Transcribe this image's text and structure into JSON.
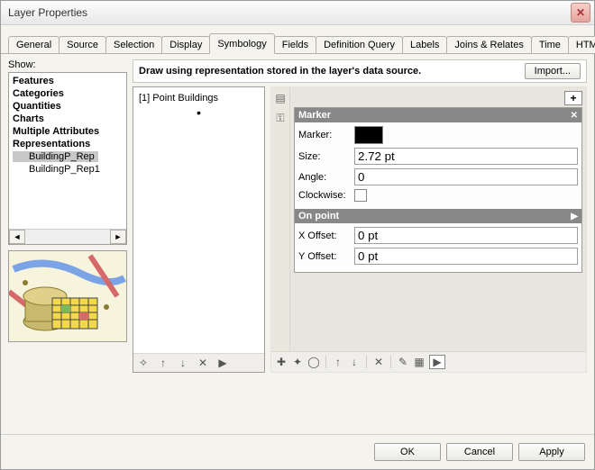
{
  "window": {
    "title": "Layer Properties"
  },
  "tabs": [
    "General",
    "Source",
    "Selection",
    "Display",
    "Symbology",
    "Fields",
    "Definition Query",
    "Labels",
    "Joins & Relates",
    "Time",
    "HTML Popup"
  ],
  "left": {
    "show_label": "Show:",
    "tree": [
      "Features",
      "Categories",
      "Quantities",
      "Charts",
      "Multiple Attributes",
      "Representations"
    ],
    "reps": [
      "BuildingP_Rep",
      "BuildingP_Rep1"
    ]
  },
  "main": {
    "description": "Draw using representation stored in the layer's data source.",
    "import_label": "Import..."
  },
  "rules": [
    {
      "label": "[1] Point Buildings"
    }
  ],
  "props": {
    "marker_header": "Marker",
    "marker_label": "Marker:",
    "size_label": "Size:",
    "size_value": "2.72 pt",
    "angle_label": "Angle:",
    "angle_value": "0",
    "clockwise_label": "Clockwise:",
    "onpoint_header": "On point",
    "xoffset_label": "X Offset:",
    "xoffset_value": "0 pt",
    "yoffset_label": "Y Offset:",
    "yoffset_value": "0 pt"
  },
  "footer": {
    "ok": "OK",
    "cancel": "Cancel",
    "apply": "Apply"
  }
}
